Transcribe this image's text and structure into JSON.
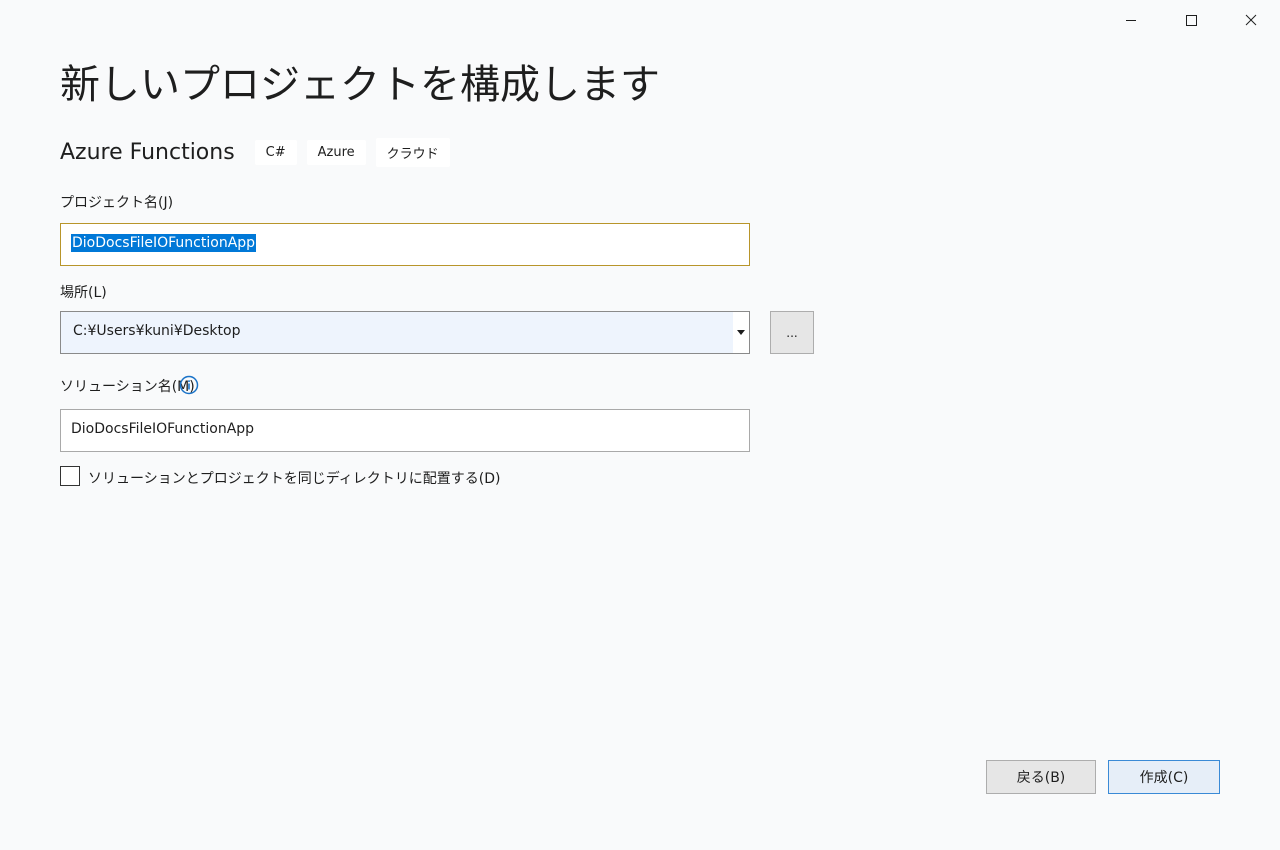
{
  "window": {
    "minimize_icon": "minimize-icon",
    "maximize_icon": "maximize-icon",
    "close_icon": "close-icon"
  },
  "header": {
    "title": "新しいプロジェクトを構成します"
  },
  "template": {
    "name": "Azure Functions",
    "tags": [
      "C#",
      "Azure",
      "クラウド"
    ]
  },
  "form": {
    "project_name_label": "プロジェクト名(J)",
    "project_name_value": "DioDocsFileIOFunctionApp",
    "location_label": "場所(L)",
    "location_value": "C:¥Users¥kuni¥Desktop",
    "browse_label": "...",
    "solution_name_label": "ソリューション名(M)",
    "solution_name_value": "DioDocsFileIOFunctionApp",
    "same_dir_checkbox_label": "ソリューションとプロジェクトを同じディレクトリに配置する(D)",
    "same_dir_checked": false
  },
  "footer": {
    "back_label": "戻る(B)",
    "create_label": "作成(C)"
  },
  "colors": {
    "background": "#f9fafb",
    "selection": "#0078d7",
    "focus_border": "#b8952a",
    "info_blue": "#1a73c8",
    "primary_border": "#3a8ad6"
  }
}
